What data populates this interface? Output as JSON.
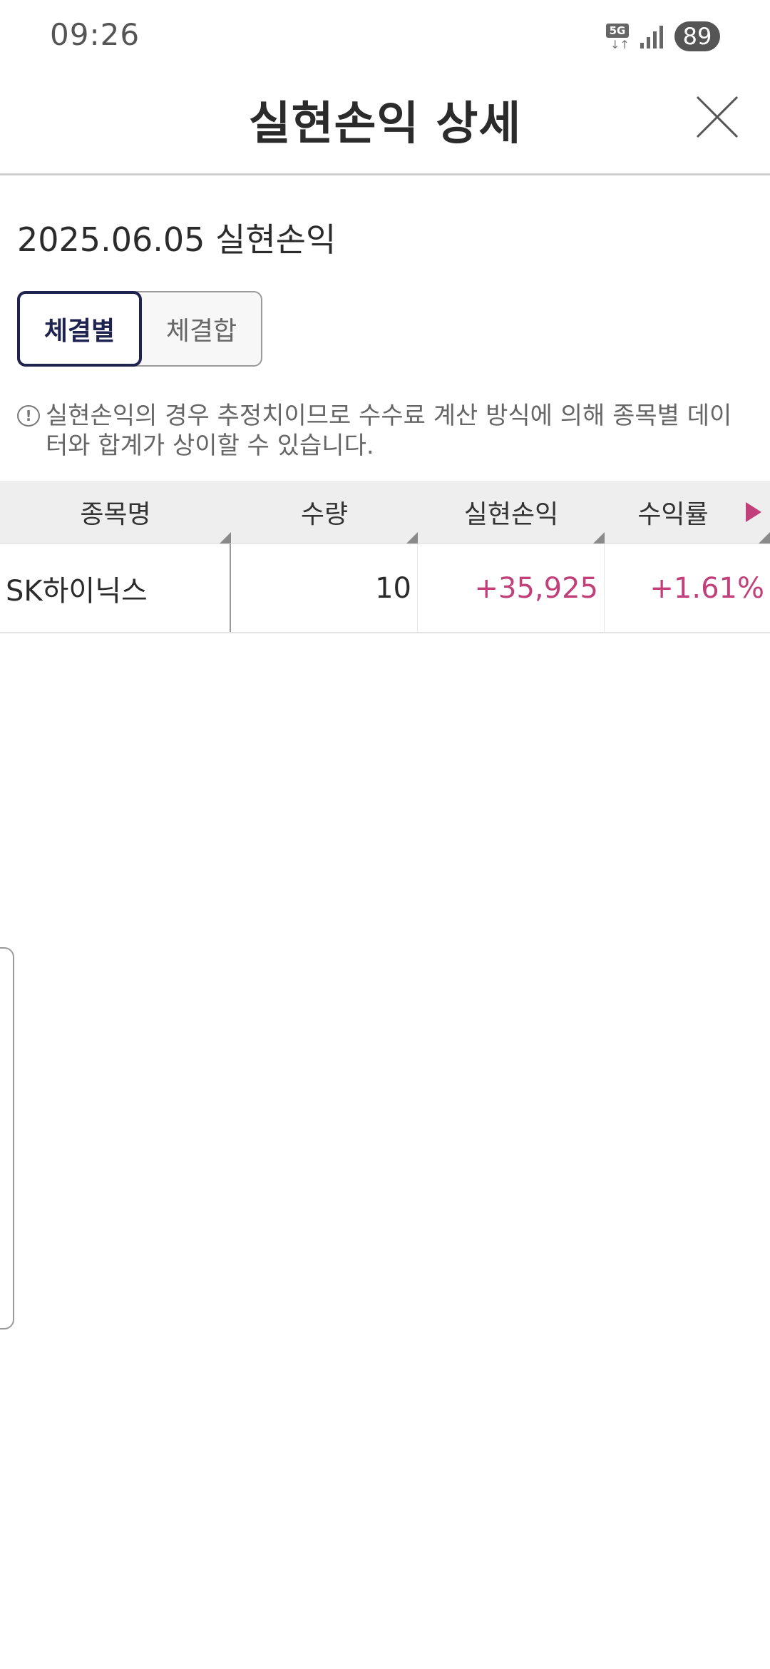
{
  "status_bar": {
    "time": "09:26",
    "network_label": "5G",
    "battery": "89"
  },
  "header": {
    "title": "실현손익 상세"
  },
  "content": {
    "date_title": "2025.06.05 실현손익",
    "toggle": {
      "option_1": "체결별",
      "option_2": "체결합",
      "selected": "체결별"
    },
    "notice_icon_glyph": "!",
    "notice": "실현손익의 경우 추정치이므로 수수료 계산 방식에 의해 종목별 데이터와 합계가 상이할 수 있습니다."
  },
  "table": {
    "columns": {
      "name": "종목명",
      "quantity": "수량",
      "realized_pnl": "실현손익",
      "return_rate": "수익률"
    },
    "rows": [
      {
        "name": "SK하이닉스",
        "quantity": "10",
        "realized_pnl": "+35,925",
        "return_rate": "+1.61%"
      }
    ]
  },
  "colors": {
    "accent_navy": "#1f2350",
    "positive": "#c2407a"
  }
}
